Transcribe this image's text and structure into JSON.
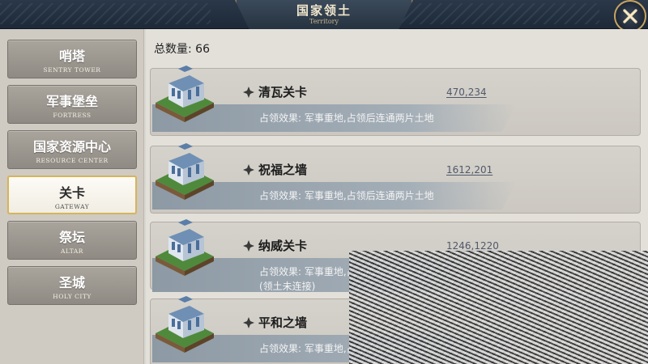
{
  "header": {
    "title": "国家领土",
    "subtitle": "Territory"
  },
  "sidebar": {
    "tabs": [
      {
        "label": "哨塔",
        "sub": "SENTRY TOWER",
        "active": false
      },
      {
        "label": "军事堡垒",
        "sub": "FORTRESS",
        "active": false
      },
      {
        "label": "国家资源中心",
        "sub": "RESOURCE CENTER",
        "active": false
      },
      {
        "label": "关卡",
        "sub": "GATEWAY",
        "active": true
      },
      {
        "label": "祭坛",
        "sub": "ALTAR",
        "active": false
      },
      {
        "label": "圣城",
        "sub": "HOLY CITY",
        "active": false
      }
    ]
  },
  "main": {
    "total_label": "总数量: 66",
    "items": [
      {
        "name": "清瓦关卡",
        "coords": "470,234",
        "effect": "占领效果: 军事重地,占领后连通两片土地",
        "extra": ""
      },
      {
        "name": "祝福之墙",
        "coords": "1612,201",
        "effect": "占领效果: 军事重地,占领后连通两片土地",
        "extra": ""
      },
      {
        "name": "纳威关卡",
        "coords": "1246,1220",
        "effect": "占领效果: 军事重地,占领后连通两片土地",
        "extra": "(领土未连接)"
      },
      {
        "name": "平和之墙",
        "coords": "",
        "effect": "占领效果: 军事重地,占领后连通两片土地",
        "extra": ""
      }
    ]
  },
  "colors": {
    "gold_border": "#d6b45a",
    "header_bg": "#1d2938",
    "panel_bg": "#e3e0da"
  },
  "icons": {
    "close": "close-x-icon",
    "item_bullet": "diamond-icon",
    "thumbnail": "fortress-tile-icon"
  }
}
